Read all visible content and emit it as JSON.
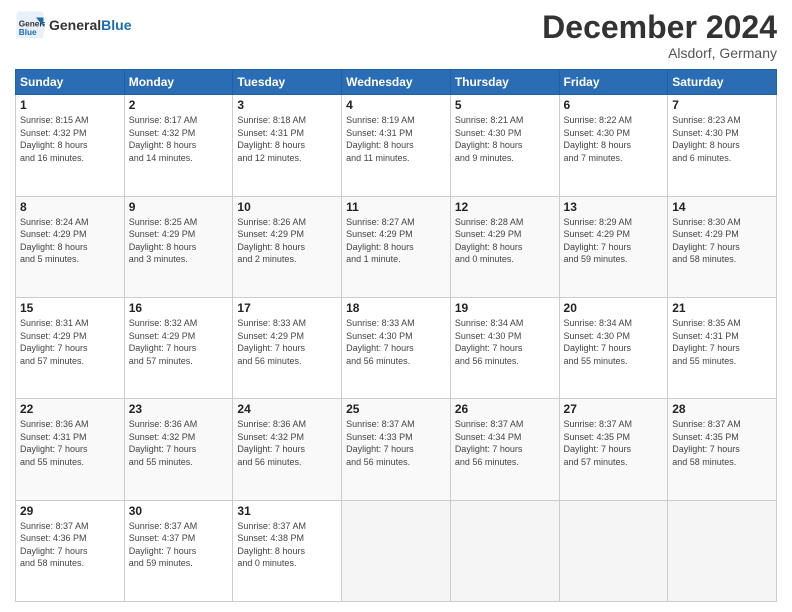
{
  "header": {
    "logo_line1": "General",
    "logo_line2": "Blue",
    "month": "December 2024",
    "location": "Alsdorf, Germany"
  },
  "weekdays": [
    "Sunday",
    "Monday",
    "Tuesday",
    "Wednesday",
    "Thursday",
    "Friday",
    "Saturday"
  ],
  "weeks": [
    [
      {
        "day": 1,
        "lines": [
          "Sunrise: 8:15 AM",
          "Sunset: 4:32 PM",
          "Daylight: 8 hours",
          "and 16 minutes."
        ]
      },
      {
        "day": 2,
        "lines": [
          "Sunrise: 8:17 AM",
          "Sunset: 4:32 PM",
          "Daylight: 8 hours",
          "and 14 minutes."
        ]
      },
      {
        "day": 3,
        "lines": [
          "Sunrise: 8:18 AM",
          "Sunset: 4:31 PM",
          "Daylight: 8 hours",
          "and 12 minutes."
        ]
      },
      {
        "day": 4,
        "lines": [
          "Sunrise: 8:19 AM",
          "Sunset: 4:31 PM",
          "Daylight: 8 hours",
          "and 11 minutes."
        ]
      },
      {
        "day": 5,
        "lines": [
          "Sunrise: 8:21 AM",
          "Sunset: 4:30 PM",
          "Daylight: 8 hours",
          "and 9 minutes."
        ]
      },
      {
        "day": 6,
        "lines": [
          "Sunrise: 8:22 AM",
          "Sunset: 4:30 PM",
          "Daylight: 8 hours",
          "and 7 minutes."
        ]
      },
      {
        "day": 7,
        "lines": [
          "Sunrise: 8:23 AM",
          "Sunset: 4:30 PM",
          "Daylight: 8 hours",
          "and 6 minutes."
        ]
      }
    ],
    [
      {
        "day": 8,
        "lines": [
          "Sunrise: 8:24 AM",
          "Sunset: 4:29 PM",
          "Daylight: 8 hours",
          "and 5 minutes."
        ]
      },
      {
        "day": 9,
        "lines": [
          "Sunrise: 8:25 AM",
          "Sunset: 4:29 PM",
          "Daylight: 8 hours",
          "and 3 minutes."
        ]
      },
      {
        "day": 10,
        "lines": [
          "Sunrise: 8:26 AM",
          "Sunset: 4:29 PM",
          "Daylight: 8 hours",
          "and 2 minutes."
        ]
      },
      {
        "day": 11,
        "lines": [
          "Sunrise: 8:27 AM",
          "Sunset: 4:29 PM",
          "Daylight: 8 hours",
          "and 1 minute."
        ]
      },
      {
        "day": 12,
        "lines": [
          "Sunrise: 8:28 AM",
          "Sunset: 4:29 PM",
          "Daylight: 8 hours",
          "and 0 minutes."
        ]
      },
      {
        "day": 13,
        "lines": [
          "Sunrise: 8:29 AM",
          "Sunset: 4:29 PM",
          "Daylight: 7 hours",
          "and 59 minutes."
        ]
      },
      {
        "day": 14,
        "lines": [
          "Sunrise: 8:30 AM",
          "Sunset: 4:29 PM",
          "Daylight: 7 hours",
          "and 58 minutes."
        ]
      }
    ],
    [
      {
        "day": 15,
        "lines": [
          "Sunrise: 8:31 AM",
          "Sunset: 4:29 PM",
          "Daylight: 7 hours",
          "and 57 minutes."
        ]
      },
      {
        "day": 16,
        "lines": [
          "Sunrise: 8:32 AM",
          "Sunset: 4:29 PM",
          "Daylight: 7 hours",
          "and 57 minutes."
        ]
      },
      {
        "day": 17,
        "lines": [
          "Sunrise: 8:33 AM",
          "Sunset: 4:29 PM",
          "Daylight: 7 hours",
          "and 56 minutes."
        ]
      },
      {
        "day": 18,
        "lines": [
          "Sunrise: 8:33 AM",
          "Sunset: 4:30 PM",
          "Daylight: 7 hours",
          "and 56 minutes."
        ]
      },
      {
        "day": 19,
        "lines": [
          "Sunrise: 8:34 AM",
          "Sunset: 4:30 PM",
          "Daylight: 7 hours",
          "and 56 minutes."
        ]
      },
      {
        "day": 20,
        "lines": [
          "Sunrise: 8:34 AM",
          "Sunset: 4:30 PM",
          "Daylight: 7 hours",
          "and 55 minutes."
        ]
      },
      {
        "day": 21,
        "lines": [
          "Sunrise: 8:35 AM",
          "Sunset: 4:31 PM",
          "Daylight: 7 hours",
          "and 55 minutes."
        ]
      }
    ],
    [
      {
        "day": 22,
        "lines": [
          "Sunrise: 8:36 AM",
          "Sunset: 4:31 PM",
          "Daylight: 7 hours",
          "and 55 minutes."
        ]
      },
      {
        "day": 23,
        "lines": [
          "Sunrise: 8:36 AM",
          "Sunset: 4:32 PM",
          "Daylight: 7 hours",
          "and 55 minutes."
        ]
      },
      {
        "day": 24,
        "lines": [
          "Sunrise: 8:36 AM",
          "Sunset: 4:32 PM",
          "Daylight: 7 hours",
          "and 56 minutes."
        ]
      },
      {
        "day": 25,
        "lines": [
          "Sunrise: 8:37 AM",
          "Sunset: 4:33 PM",
          "Daylight: 7 hours",
          "and 56 minutes."
        ]
      },
      {
        "day": 26,
        "lines": [
          "Sunrise: 8:37 AM",
          "Sunset: 4:34 PM",
          "Daylight: 7 hours",
          "and 56 minutes."
        ]
      },
      {
        "day": 27,
        "lines": [
          "Sunrise: 8:37 AM",
          "Sunset: 4:35 PM",
          "Daylight: 7 hours",
          "and 57 minutes."
        ]
      },
      {
        "day": 28,
        "lines": [
          "Sunrise: 8:37 AM",
          "Sunset: 4:35 PM",
          "Daylight: 7 hours",
          "and 58 minutes."
        ]
      }
    ],
    [
      {
        "day": 29,
        "lines": [
          "Sunrise: 8:37 AM",
          "Sunset: 4:36 PM",
          "Daylight: 7 hours",
          "and 58 minutes."
        ]
      },
      {
        "day": 30,
        "lines": [
          "Sunrise: 8:37 AM",
          "Sunset: 4:37 PM",
          "Daylight: 7 hours",
          "and 59 minutes."
        ]
      },
      {
        "day": 31,
        "lines": [
          "Sunrise: 8:37 AM",
          "Sunset: 4:38 PM",
          "Daylight: 8 hours",
          "and 0 minutes."
        ]
      },
      null,
      null,
      null,
      null
    ]
  ]
}
